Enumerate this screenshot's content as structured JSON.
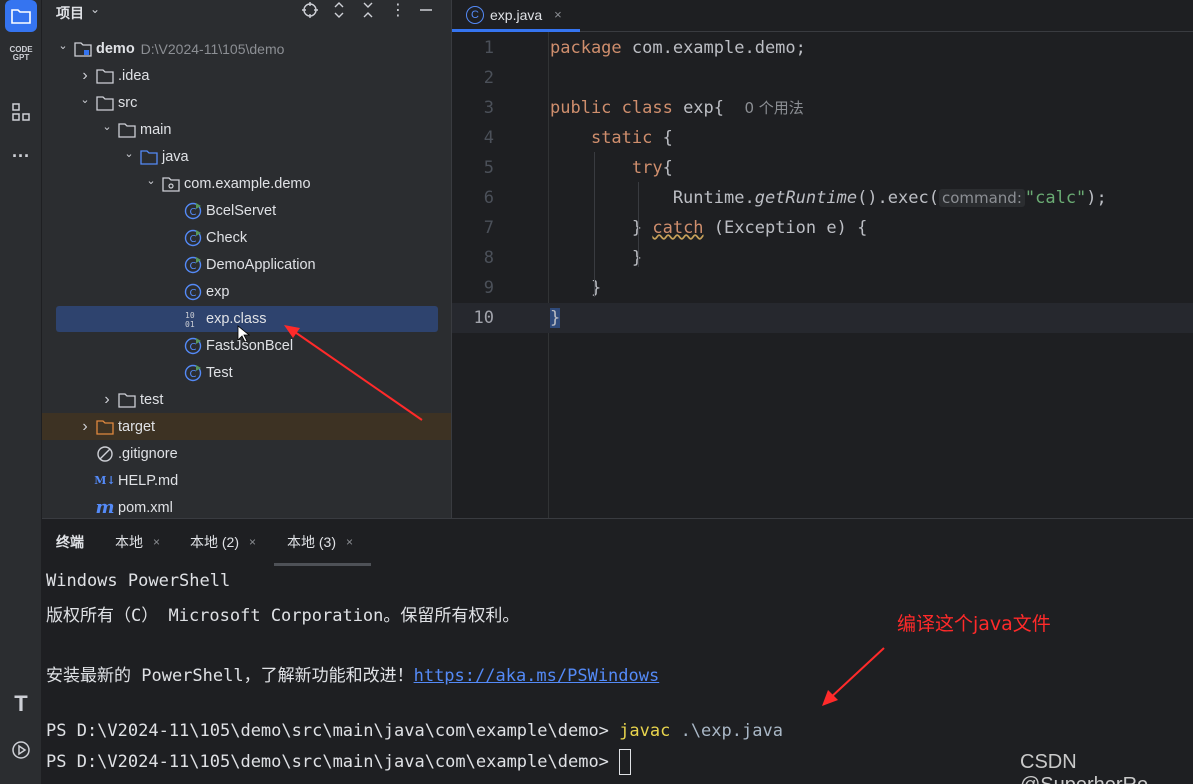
{
  "activity_bar": {
    "items": [
      {
        "name": "project-icon",
        "active": true
      },
      {
        "name": "codegpt-icon",
        "label": "CODE GPT"
      },
      {
        "name": "structure-icon"
      },
      {
        "name": "more-icon",
        "glyph": "···"
      }
    ],
    "bottom_items": [
      {
        "name": "terminal-text-icon",
        "glyph": "T"
      },
      {
        "name": "run-icon",
        "glyph": "▷"
      }
    ]
  },
  "project_panel": {
    "title": "项目",
    "tree": [
      {
        "label": "demo",
        "path": "D:\\V2024-11\\105\\demo",
        "depth": 0,
        "expanded": true,
        "icon": "module-folder-icon",
        "bold": true
      },
      {
        "label": ".idea",
        "depth": 1,
        "expanded": false,
        "icon": "folder-icon"
      },
      {
        "label": "src",
        "depth": 1,
        "expanded": true,
        "icon": "folder-icon"
      },
      {
        "label": "main",
        "depth": 2,
        "expanded": true,
        "icon": "folder-icon"
      },
      {
        "label": "java",
        "depth": 3,
        "expanded": true,
        "icon": "source-folder-icon"
      },
      {
        "label": "com.example.demo",
        "depth": 4,
        "expanded": true,
        "icon": "package-icon"
      },
      {
        "label": "BcelServet",
        "depth": 5,
        "icon": "class-run-icon"
      },
      {
        "label": "Check",
        "depth": 5,
        "icon": "class-run-icon"
      },
      {
        "label": "DemoApplication",
        "depth": 5,
        "icon": "class-run-icon"
      },
      {
        "label": "exp",
        "depth": 5,
        "icon": "class-icon"
      },
      {
        "label": "exp.class",
        "depth": 5,
        "icon": "binary-class-icon",
        "selected": true
      },
      {
        "label": "FastJsonBcel",
        "depth": 5,
        "icon": "class-run-icon"
      },
      {
        "label": "Test",
        "depth": 5,
        "icon": "class-run-icon"
      },
      {
        "label": "test",
        "depth": 2,
        "expanded": false,
        "icon": "folder-icon"
      },
      {
        "label": "target",
        "depth": 1,
        "expanded": false,
        "icon": "excluded-folder-icon",
        "excluded": true
      },
      {
        "label": ".gitignore",
        "depth": 1,
        "icon": "gitignore-icon"
      },
      {
        "label": "HELP.md",
        "depth": 1,
        "icon": "markdown-icon",
        "badge": "M↓"
      },
      {
        "label": "pom.xml",
        "depth": 1,
        "icon": "maven-icon",
        "badge": "m"
      }
    ]
  },
  "editor": {
    "tab": {
      "label": "exp.java",
      "close": "×"
    },
    "lines": [
      {
        "n": "1",
        "html": "<span class='kw'>package</span> com.example.demo;"
      },
      {
        "n": "2",
        "html": ""
      },
      {
        "n": "3",
        "html": "<span class='kw'>public class</span> exp{  <span class='hint'>0 个用法</span>"
      },
      {
        "n": "4",
        "html": "    <span class='kw'>static</span> {"
      },
      {
        "n": "5",
        "html": "        <span class='kw'>try</span>{"
      },
      {
        "n": "6",
        "html": "            Runtime.<span class='ital'>getRuntime</span>().exec(<span class='hintbox'>command:</span><span class='str'>\"calc\"</span>);"
      },
      {
        "n": "7",
        "html": "        } <span class='kw warn'>catch</span> (Exception e) {"
      },
      {
        "n": "8",
        "html": "        }"
      },
      {
        "n": "9",
        "html": "    }"
      },
      {
        "n": "10",
        "html": "<span class='brace-hl'>}</span>",
        "current": true
      }
    ]
  },
  "terminal": {
    "tabs": [
      {
        "label": "终端",
        "bold": true
      },
      {
        "label": "本地",
        "close": "×"
      },
      {
        "label": "本地 (2)",
        "close": "×"
      },
      {
        "label": "本地 (3)",
        "close": "×",
        "active": true
      }
    ],
    "line1": "Windows PowerShell",
    "line2": "版权所有（C） Microsoft Corporation。保留所有权利。",
    "line3_text": "安装最新的 PowerShell，了解新功能和改进！",
    "line3_link": "https://aka.ms/PSWindows",
    "prompt1": "PS D:\\V2024-11\\105\\demo\\src\\main\\java\\com\\example\\demo> ",
    "cmd1": "javac",
    "arg1": " .\\exp.java",
    "prompt2": "PS D:\\V2024-11\\105\\demo\\src\\main\\java\\com\\example\\demo> "
  },
  "annotations": {
    "compile_note": "编译这个java文件",
    "watermark": "CSDN @SuperherRo",
    "arrow_color": "#ff2a2a"
  }
}
